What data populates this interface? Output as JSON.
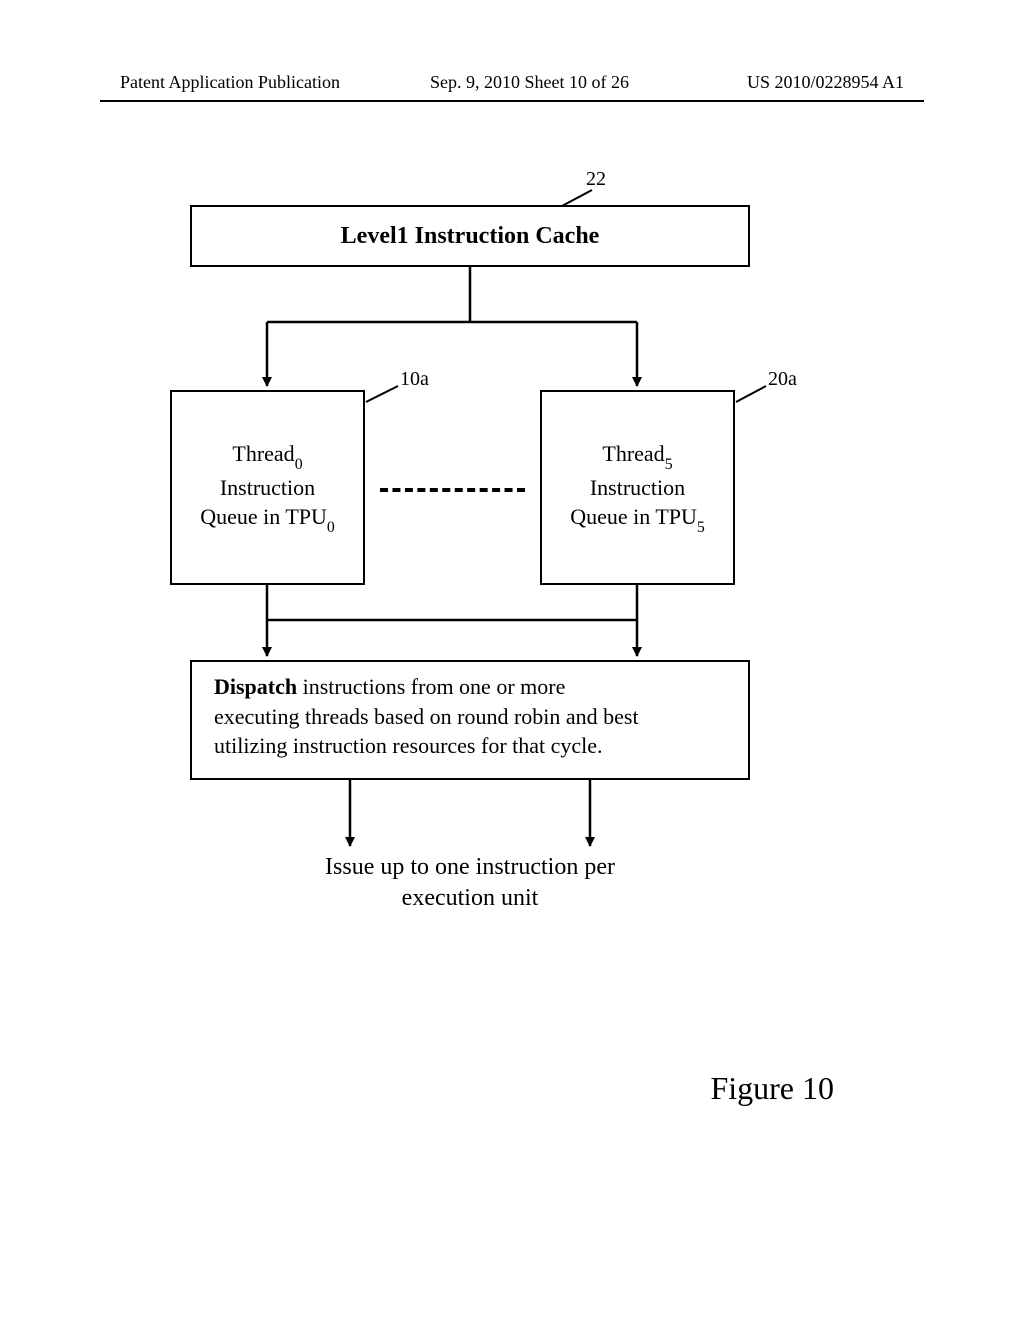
{
  "header": {
    "left": "Patent Application Publication",
    "mid": "Sep. 9, 2010  Sheet 10 of 26",
    "right": "US 2010/0228954 A1"
  },
  "refs": {
    "cache": "22",
    "thread0": "10a",
    "thread5": "20a"
  },
  "cache": {
    "title": "Level1 Instruction Cache"
  },
  "thread0": {
    "line1_pre": "Thread",
    "line1_sub": "0",
    "line2": "Instruction",
    "line3_pre": "Queue in TPU",
    "line3_sub": "0"
  },
  "thread5": {
    "line1_pre": "Thread",
    "line1_sub": "5",
    "line2": "Instruction",
    "line3_pre": "Queue in TPU",
    "line3_sub": "5"
  },
  "dispatch": {
    "bold": "Dispatch",
    "rest1": " instructions from one or more",
    "line2": "executing threads based on round robin and best",
    "line3": "utilizing instruction resources for that cycle."
  },
  "issue": {
    "line1": "Issue up to one instruction per",
    "line2": "execution unit"
  },
  "figure": "Figure 10"
}
